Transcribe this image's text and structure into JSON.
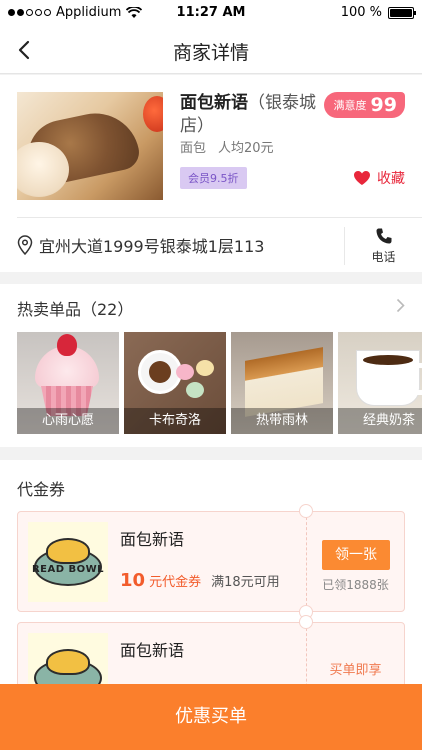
{
  "status_bar": {
    "carrier": "Applidium",
    "time": "11:27 AM",
    "battery": "100 %"
  },
  "nav": {
    "title": "商家详情"
  },
  "shop": {
    "name": "面包新语",
    "branch": "（银泰城店）",
    "category": "面包",
    "avg_price": "人均20元",
    "member_discount": "会员9.5折",
    "satisfaction_label": "满意度",
    "satisfaction_score": "99",
    "favorite_label": "收藏",
    "address": "宜州大道1999号银泰城1层113",
    "phone_label": "电话"
  },
  "hot_items": {
    "title": "热卖单品（22）",
    "items": [
      {
        "label": "心雨心愿"
      },
      {
        "label": "卡布奇洛"
      },
      {
        "label": "热带雨林"
      },
      {
        "label": "经典奶茶"
      }
    ]
  },
  "coupons": {
    "title": "代金券",
    "list": [
      {
        "logo_text": "READ BOWL",
        "name": "面包新语",
        "amount": "10",
        "unit": "元代金券",
        "condition": "满18元可用",
        "button": "领一张",
        "claimed": "已领1888张"
      },
      {
        "name": "面包新语",
        "pay_tag": "买单即享"
      }
    ]
  },
  "cta": {
    "label": "优惠买单"
  },
  "colors": {
    "accent": "#fb7f2c",
    "favorite": "#e8273b",
    "satisfaction": "#f7677b",
    "member_badge": "#d9c9f2"
  }
}
